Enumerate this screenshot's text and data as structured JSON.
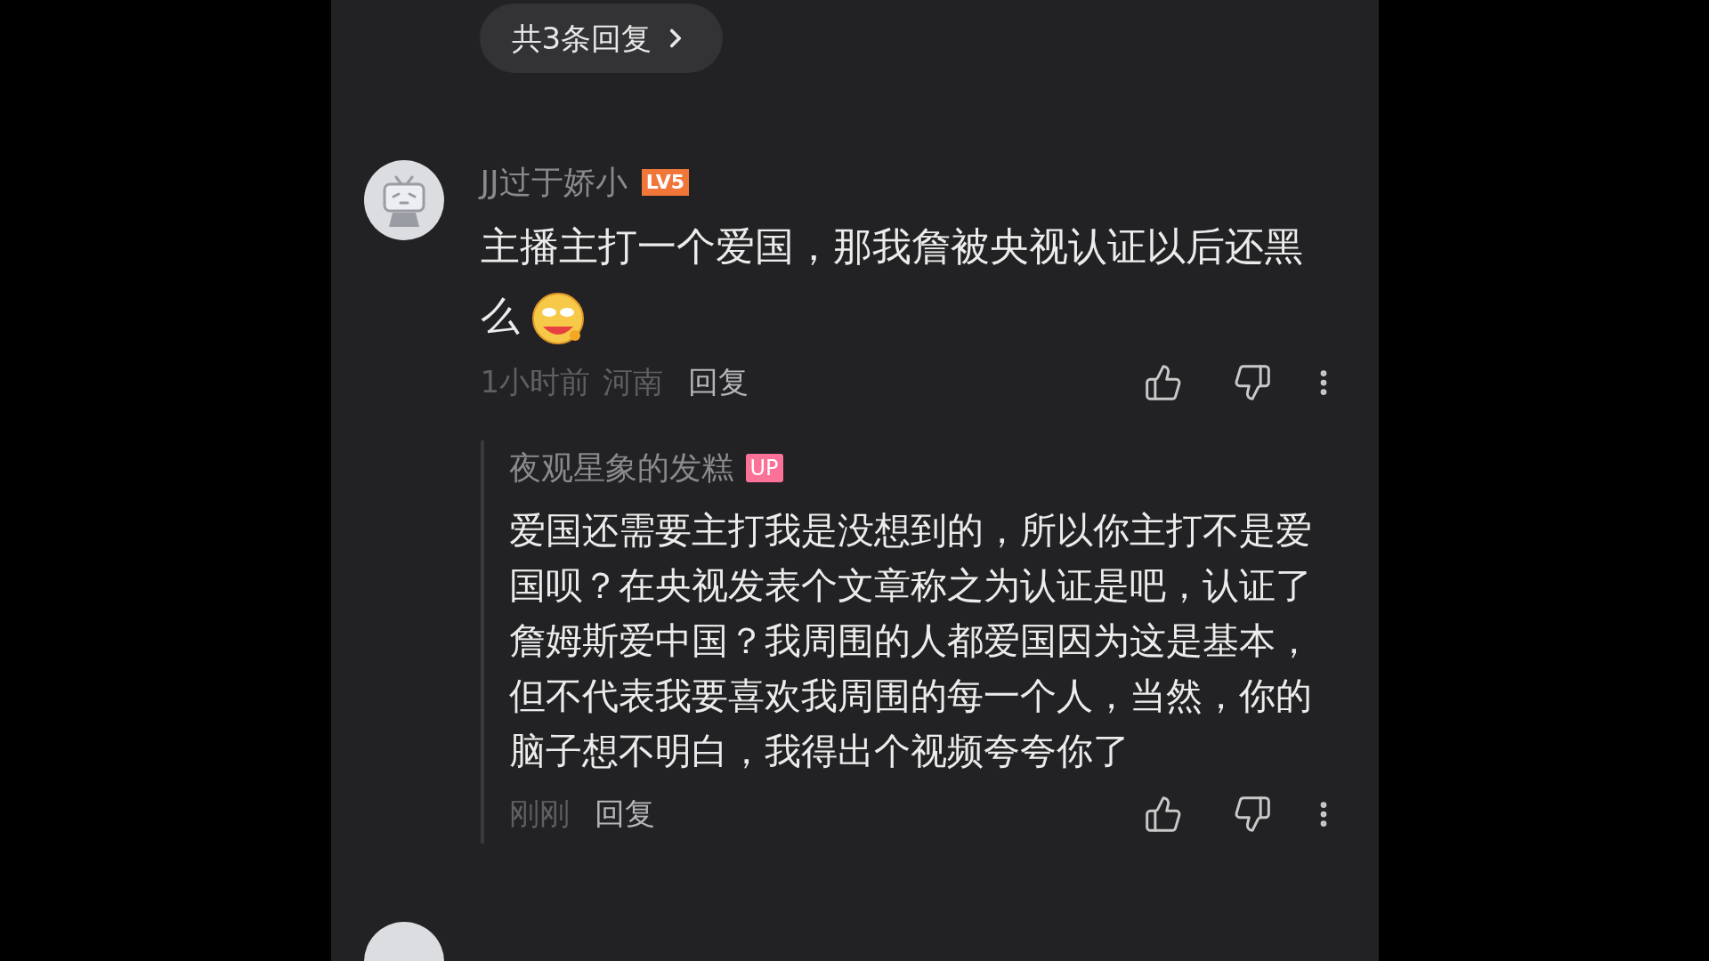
{
  "replies_toggle": {
    "label": "共3条回复"
  },
  "comment": {
    "author": "JJ过于娇小",
    "level_badge": "LV5",
    "text": "主播主打一个爱国，那我詹被央视认证以后还黑么",
    "time": "1小时前",
    "location": "河南",
    "reply_label": "回复",
    "reply": {
      "author": "夜观星象的发糕",
      "author_badge": "UP",
      "text": "爱国还需要主打我是没想到的，所以你主打不是爱国呗？在央视发表个文章称之为认证是吧，认证了詹姆斯爱中国？我周围的人都爱国因为这是基本，但不代表我要喜欢我周围的每一个人，当然，你的脑子想不明白，我得出个视频夸夸你了",
      "time": "刚刚",
      "reply_label": "回复"
    }
  }
}
